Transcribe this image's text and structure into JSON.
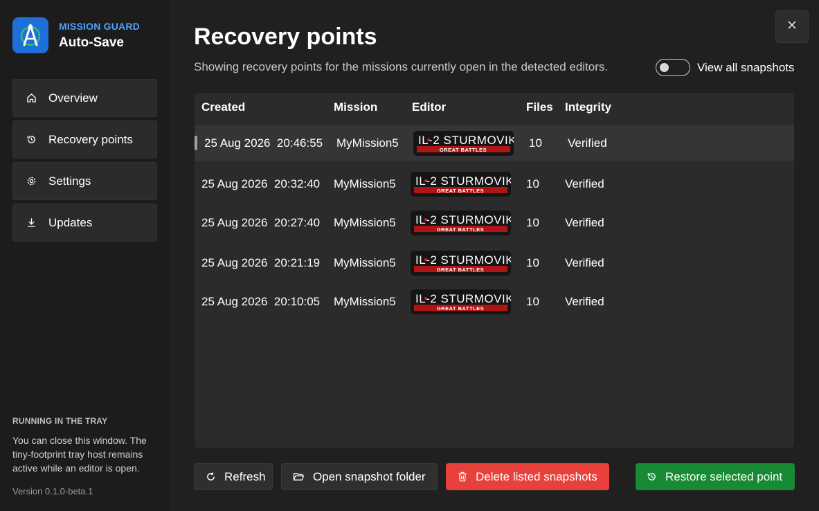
{
  "app": {
    "brand": "MISSION GUARD",
    "name": "Auto-Save",
    "brand_color": "#4aa3ff"
  },
  "nav": [
    {
      "label": "Overview",
      "icon": "home-icon"
    },
    {
      "label": "Recovery points",
      "icon": "history-icon"
    },
    {
      "label": "Settings",
      "icon": "gear-icon"
    },
    {
      "label": "Updates",
      "icon": "download-icon"
    }
  ],
  "tray": {
    "title": "RUNNING IN THE TRAY",
    "text": "You can close this window. The tiny-footprint tray host remains active while an editor is open."
  },
  "version": "Version 0.1.0-beta.1",
  "page": {
    "title": "Recovery points",
    "subtitle": "Showing recovery points for the missions currently open in the detected editors."
  },
  "toggle": {
    "label": "View all snapshots",
    "on": false
  },
  "table": {
    "headers": {
      "created": "Created",
      "mission": "Mission",
      "editor": "Editor",
      "files": "Files",
      "integrity": "Integrity"
    },
    "rows": [
      {
        "created": "25 Aug 2026  20:46:55",
        "mission": "MyMission5",
        "files": "10",
        "integrity": "Verified",
        "selected": true
      },
      {
        "created": "25 Aug 2026  20:32:40",
        "mission": "MyMission5",
        "files": "10",
        "integrity": "Verified",
        "selected": false
      },
      {
        "created": "25 Aug 2026  20:27:40",
        "mission": "MyMission5",
        "files": "10",
        "integrity": "Verified",
        "selected": false
      },
      {
        "created": "25 Aug 2026  20:21:19",
        "mission": "MyMission5",
        "files": "10",
        "integrity": "Verified",
        "selected": false
      },
      {
        "created": "25 Aug 2026  20:10:05",
        "mission": "MyMission5",
        "files": "10",
        "integrity": "Verified",
        "selected": false
      }
    ],
    "editor_logo": {
      "main": "IL-2 STURMOVIK",
      "sub": "GREAT BATTLES"
    }
  },
  "buttons": {
    "refresh": "Refresh",
    "open_folder": "Open snapshot folder",
    "delete": "Delete listed snapshots",
    "restore": "Restore selected point"
  },
  "colors": {
    "danger": "#e8413c",
    "success": "#178a33",
    "accent": "#1e6fd9"
  }
}
